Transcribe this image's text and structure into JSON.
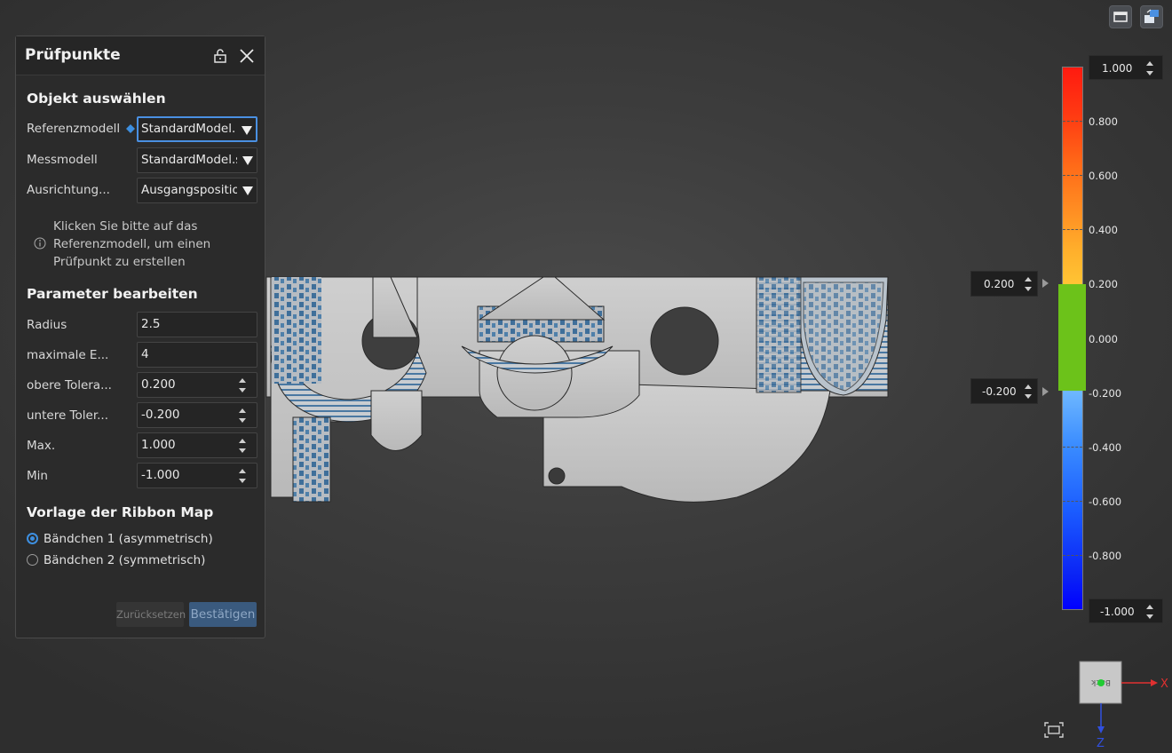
{
  "panel": {
    "title": "Prüfpunkte",
    "section_object": "Objekt auswählen",
    "rows_object": [
      {
        "label": "Referenzmodell",
        "value": "StandardModel.stl"
      },
      {
        "label": "Messmodell",
        "value": "StandardModel.stl"
      },
      {
        "label": "Ausrichtung...",
        "value": "Ausgangsposition"
      }
    ],
    "info": "Klicken Sie bitte auf das Referenzmodell, um einen Prüfpunkt zu erstellen",
    "section_params": "Parameter bearbeiten",
    "params": [
      {
        "label": "Radius",
        "value": "2.5"
      },
      {
        "label": "maximale E...",
        "value": "4"
      },
      {
        "label": "obere Tolera...",
        "value": "0.200"
      },
      {
        "label": "untere Toler...",
        "value": "-0.200"
      },
      {
        "label": "Max.",
        "value": "1.000"
      },
      {
        "label": "Min",
        "value": "-1.000"
      }
    ],
    "section_ribbon": "Vorlage der Ribbon Map",
    "ribbon_options": [
      "Bändchen 1 (asymmetrisch)",
      "Bändchen 2 (symmetrisch)"
    ],
    "ribbon_selected": 0,
    "reset_label": "Zurücksetzen",
    "confirm_label": "Bestätigen"
  },
  "colorbar": {
    "max_value": "1.000",
    "min_value": "-1.000",
    "upper_tol": "0.200",
    "lower_tol": "-0.200",
    "tick_labels": [
      "0.800",
      "0.600",
      "0.400",
      "0.200",
      "0.000",
      "-0.200",
      "-0.400",
      "-0.600",
      "-0.800"
    ],
    "tolerance_color": "#6cc21a"
  },
  "axes": {
    "x_label": "X",
    "z_label": "Z",
    "cube_label": "Back",
    "x_color": "#e03030",
    "z_color": "#3050e0"
  }
}
